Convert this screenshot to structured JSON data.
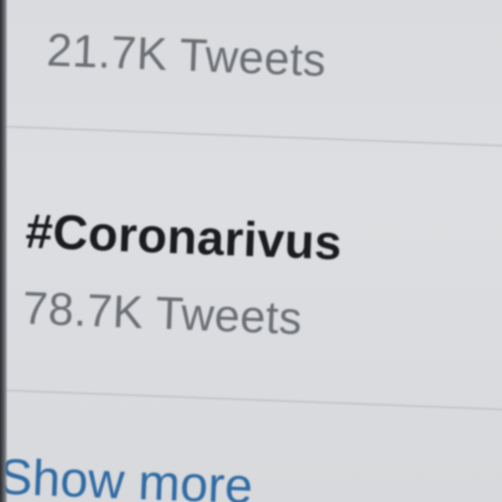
{
  "trends": [
    {
      "hashtag": "",
      "count": "21.7K Tweets"
    },
    {
      "hashtag": "#Coronarivus",
      "count": "78.7K Tweets"
    }
  ],
  "footer": {
    "show_more": "Show more"
  },
  "colors": {
    "background": "#d9dbde",
    "text_primary": "#1a1b1e",
    "text_secondary": "#6b6e73",
    "link": "#2f6aa3",
    "divider": "#bfc2c6"
  }
}
